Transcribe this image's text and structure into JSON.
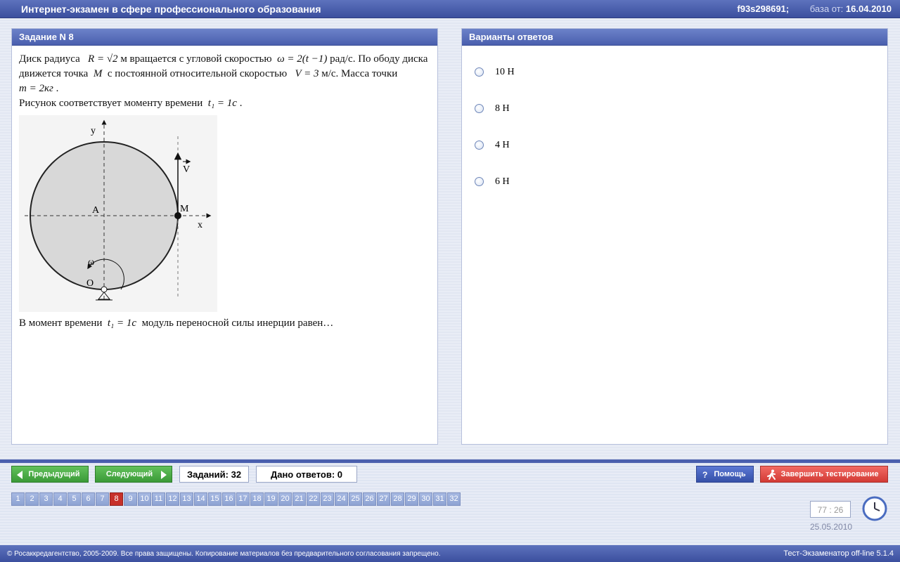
{
  "header": {
    "title": "Интернет-экзамен в сфере профессионального образования",
    "session_id": "f93s298691;",
    "base_label": "база от:",
    "base_date": "16.04.2010"
  },
  "task": {
    "title": "Задание N 8",
    "p1_a": "Диск радиуса",
    "p1_R": "R = √2",
    "p1_b": "м вращается с угловой скоростью",
    "p1_omega": "ω = 2(t −1)",
    "p1_c": "рад/с. По ободу диска",
    "p2_a": "движется точка",
    "p2_M": "M",
    "p2_b": "с постоянной относительной скоростью",
    "p2_V": "V = 3",
    "p2_c": "м/с. Масса точки",
    "p3_m": "m = 2кг",
    "p3_dot": ".",
    "p4_a": "Рисунок соответствует моменту времени",
    "p4_t": "t₁ = 1с",
    "p4_dot": ".",
    "q_a": "В момент времени",
    "q_t": "t₁ = 1с",
    "q_b": "модуль переносной силы инерции равен…",
    "figure": {
      "y": "y",
      "x": "x",
      "A": "A",
      "M": "M",
      "V": "V",
      "omega": "ω",
      "O": "O"
    }
  },
  "answers": {
    "title": "Варианты ответов",
    "options": [
      {
        "label": "10 Н"
      },
      {
        "label": "8 Н"
      },
      {
        "label": "4 Н"
      },
      {
        "label": "6 Н"
      }
    ]
  },
  "nav": {
    "prev_label": "Предыдущий",
    "next_label": "Следующий",
    "tasks_count": "Заданий: 32",
    "answers_given": "Дано ответов: 0",
    "help_label": "Помощь",
    "finish_label": "Завершить тестирование",
    "current_task": 8,
    "task_numbers": [
      "1",
      "2",
      "3",
      "4",
      "5",
      "6",
      "7",
      "8",
      "9",
      "10",
      "11",
      "12",
      "13",
      "14",
      "15",
      "16",
      "17",
      "18",
      "19",
      "20",
      "21",
      "22",
      "23",
      "24",
      "25",
      "26",
      "27",
      "28",
      "29",
      "30",
      "31",
      "32"
    ]
  },
  "status": {
    "timer": "77 : 26",
    "date": "25.05.2010"
  },
  "footer": {
    "copyright": "© Росаккредагентство, 2005-2009. Все права защищены. Копирование материалов без предварительного согласования запрещено.",
    "version": "Тест-Экзаменатор off-line 5.1.4"
  },
  "colors": {
    "header_blue": "#4a5fae",
    "green_button": "#3a9a37",
    "red_button": "#d23a35",
    "active_task": "#c7302a"
  },
  "icons": [
    "arrow-left-icon",
    "arrow-right-icon",
    "help-icon",
    "runner-icon",
    "clock-icon"
  ]
}
